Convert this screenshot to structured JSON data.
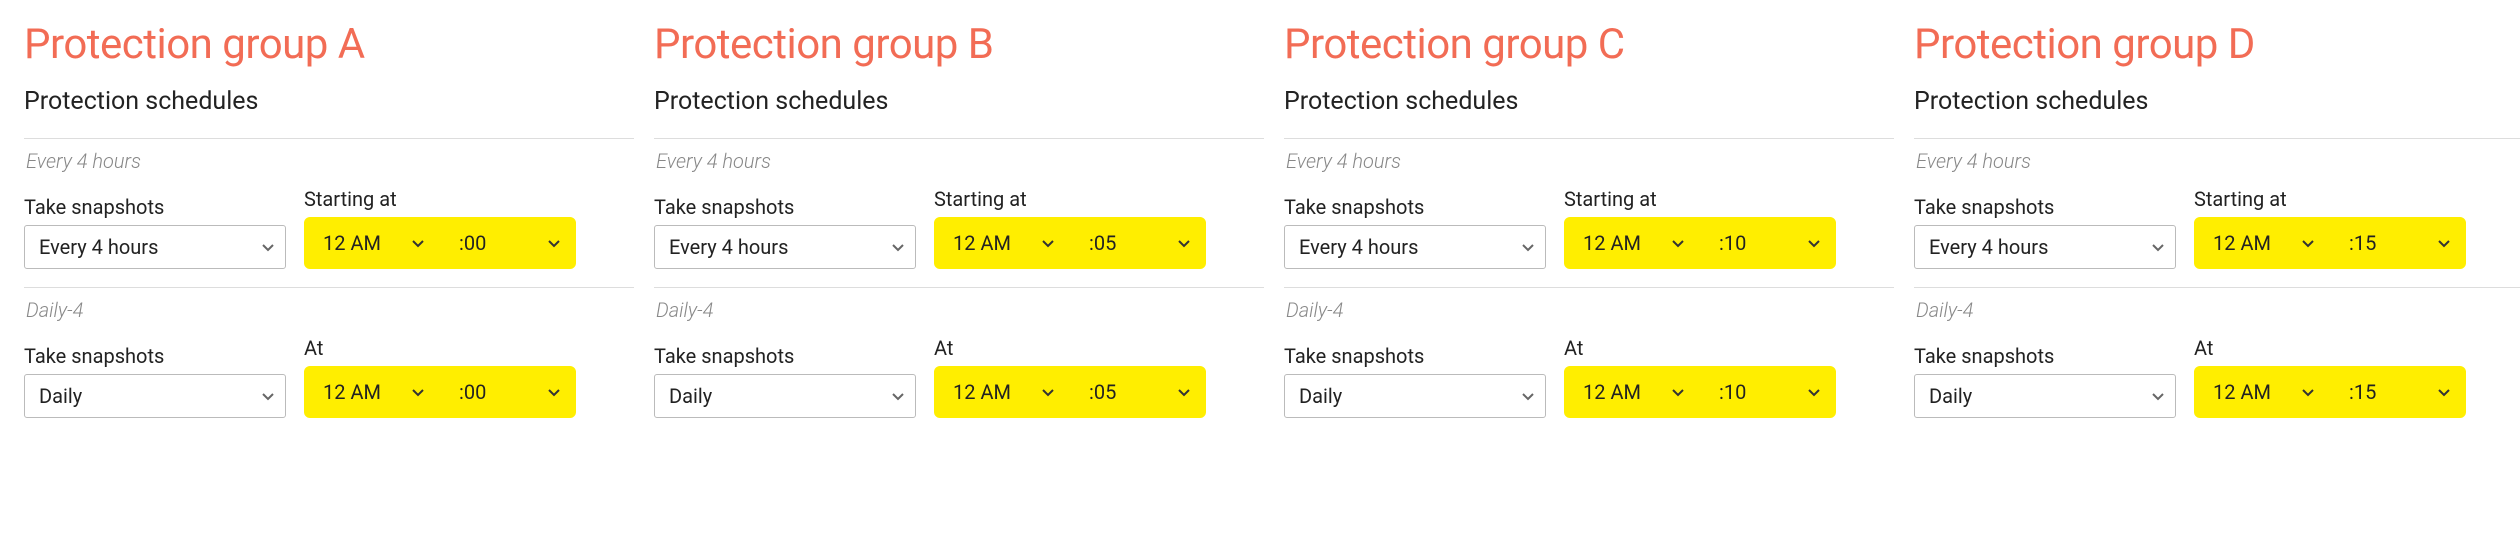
{
  "labels": {
    "section": "Protection schedules",
    "take_snapshots": "Take snapshots",
    "starting_at": "Starting at",
    "at": "At"
  },
  "groups": [
    {
      "title": "Protection group A",
      "schedules": [
        {
          "name": "Every 4 hours",
          "freq": "Every 4 hours",
          "time_label_key": "starting_at",
          "hour": "12 AM",
          "minute": ":00"
        },
        {
          "name": "Daily-4",
          "freq": "Daily",
          "time_label_key": "at",
          "hour": "12 AM",
          "minute": ":00"
        }
      ]
    },
    {
      "title": "Protection group B",
      "schedules": [
        {
          "name": "Every 4 hours",
          "freq": "Every 4 hours",
          "time_label_key": "starting_at",
          "hour": "12 AM",
          "minute": ":05"
        },
        {
          "name": "Daily-4",
          "freq": "Daily",
          "time_label_key": "at",
          "hour": "12 AM",
          "minute": ":05"
        }
      ]
    },
    {
      "title": "Protection group C",
      "schedules": [
        {
          "name": "Every 4 hours",
          "freq": "Every 4 hours",
          "time_label_key": "starting_at",
          "hour": "12 AM",
          "minute": ":10"
        },
        {
          "name": "Daily-4",
          "freq": "Daily",
          "time_label_key": "at",
          "hour": "12 AM",
          "minute": ":10"
        }
      ]
    },
    {
      "title": "Protection group D",
      "schedules": [
        {
          "name": "Every 4 hours",
          "freq": "Every 4 hours",
          "time_label_key": "starting_at",
          "hour": "12 AM",
          "minute": ":15"
        },
        {
          "name": "Daily-4",
          "freq": "Daily",
          "time_label_key": "at",
          "hour": "12 AM",
          "minute": ":15"
        }
      ]
    }
  ],
  "colors": {
    "accent": "#F26C55",
    "highlight": "#FFEE00"
  }
}
